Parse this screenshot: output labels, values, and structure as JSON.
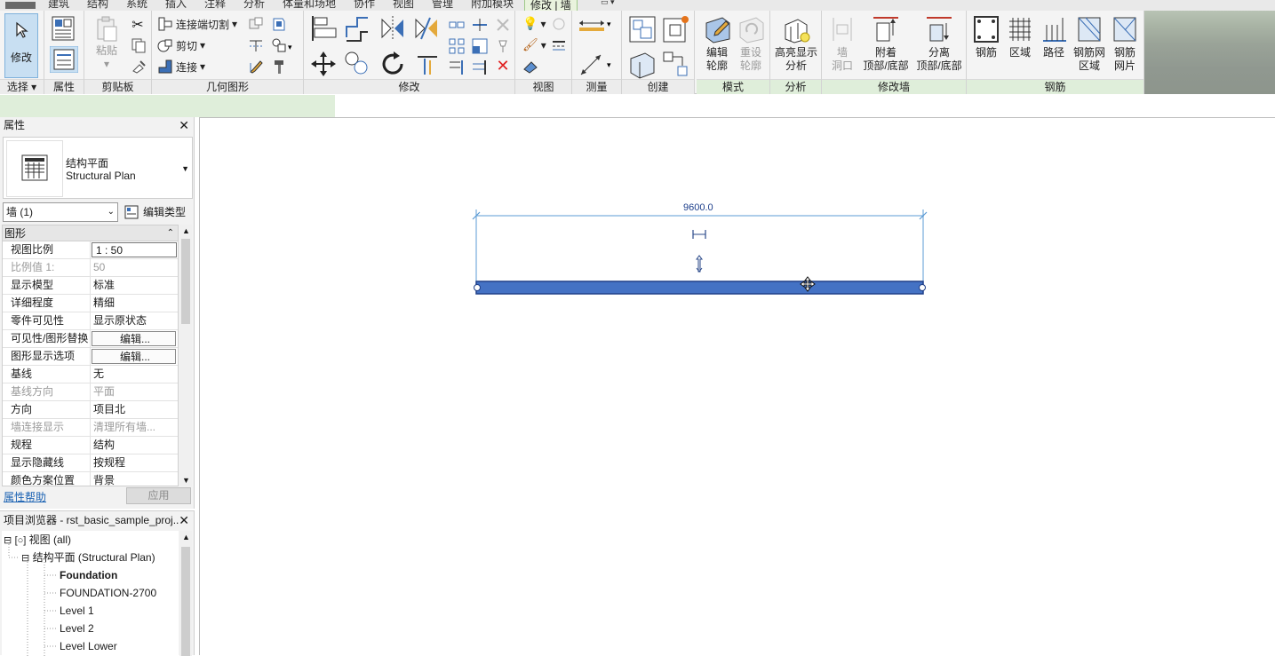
{
  "menu_tabs": [
    "建筑",
    "结构",
    "系统",
    "插入",
    "注释",
    "分析",
    "体量和场地",
    "协作",
    "视图",
    "管理",
    "附加模块",
    "修改 | 墙"
  ],
  "ribbon": {
    "select": {
      "modify": "修改",
      "panel": "选择"
    },
    "properties_panel": "属性",
    "clipboard": {
      "paste": "粘贴",
      "panel": "剪贴板"
    },
    "geometry": {
      "cope": "连接端切割",
      "cut": "剪切",
      "join": "连接",
      "panel": "几何图形"
    },
    "modify_panel": "修改",
    "view_panel": "视图",
    "measure_panel": "测量",
    "create_panel": "创建",
    "mode": {
      "edit_profile": [
        "编辑",
        "轮廓"
      ],
      "reset_profile": [
        "重设",
        "轮廓"
      ],
      "panel": "模式"
    },
    "analysis": {
      "highlight": [
        "高亮显示",
        "分析"
      ],
      "panel": "分析"
    },
    "modify_wall": {
      "wall_opening": [
        "墙",
        "洞口"
      ],
      "attach": [
        "附着",
        "顶部/底部"
      ],
      "detach": [
        "分离",
        "顶部/底部"
      ],
      "panel": "修改墙"
    },
    "rebar": {
      "rebar": "钢筋",
      "area": "区域",
      "path": "路径",
      "fabric_area": [
        "钢筋网",
        "区域"
      ],
      "fabric_sheet": [
        "钢筋",
        "网片"
      ],
      "panel": "钢筋"
    }
  },
  "properties": {
    "title": "属性",
    "type_name_cn": "结构平面",
    "type_name_en": "Structural Plan",
    "instance_filter": "墙 (1)",
    "edit_type": "编辑类型",
    "group": "图形",
    "rows": [
      {
        "k": "视图比例",
        "v": "1 : 50"
      },
      {
        "k": "比例值 1:",
        "v": "50"
      },
      {
        "k": "显示模型",
        "v": "标准"
      },
      {
        "k": "详细程度",
        "v": "精细"
      },
      {
        "k": "零件可见性",
        "v": "显示原状态"
      },
      {
        "k": "可见性/图形替换",
        "v": "编辑..."
      },
      {
        "k": "图形显示选项",
        "v": "编辑..."
      },
      {
        "k": "基线",
        "v": "无"
      },
      {
        "k": "基线方向",
        "v": "平面"
      },
      {
        "k": "方向",
        "v": "项目北"
      },
      {
        "k": "墙连接显示",
        "v": "清理所有墙..."
      },
      {
        "k": "规程",
        "v": "结构"
      },
      {
        "k": "显示隐藏线",
        "v": "按规程"
      },
      {
        "k": "颜色方案位置",
        "v": "背景"
      }
    ],
    "help": "属性帮助",
    "apply": "应用"
  },
  "browser": {
    "title": "项目浏览器 - rst_basic_sample_proj...",
    "items": [
      {
        "label": "视图 (all)",
        "level": 0
      },
      {
        "label": "结构平面 (Structural Plan)",
        "level": 1
      },
      {
        "label": "Foundation",
        "level": 2,
        "bold": true
      },
      {
        "label": "FOUNDATION-2700",
        "level": 2
      },
      {
        "label": "Level 1",
        "level": 2
      },
      {
        "label": "Level 2",
        "level": 2
      },
      {
        "label": "Level Lower",
        "level": 2
      }
    ]
  },
  "canvas": {
    "dimension_text": "9600.0",
    "wall_color": "#4472c4",
    "dim_color": "#5b9bd5"
  }
}
